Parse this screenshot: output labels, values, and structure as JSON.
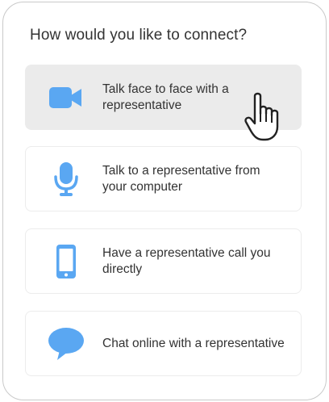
{
  "heading": "How would you like to connect?",
  "colors": {
    "accent": "#5aa7f2",
    "text": "#333333",
    "selected_bg": "#ebebeb"
  },
  "options": [
    {
      "label": "Talk face to face with a representative",
      "icon": "video-camera-icon",
      "selected": true
    },
    {
      "label": "Talk to a representative from your computer",
      "icon": "microphone-icon",
      "selected": false
    },
    {
      "label": "Have a representative call you directly",
      "icon": "smartphone-icon",
      "selected": false
    },
    {
      "label": "Chat online with a representative",
      "icon": "chat-bubble-icon",
      "selected": false
    }
  ]
}
